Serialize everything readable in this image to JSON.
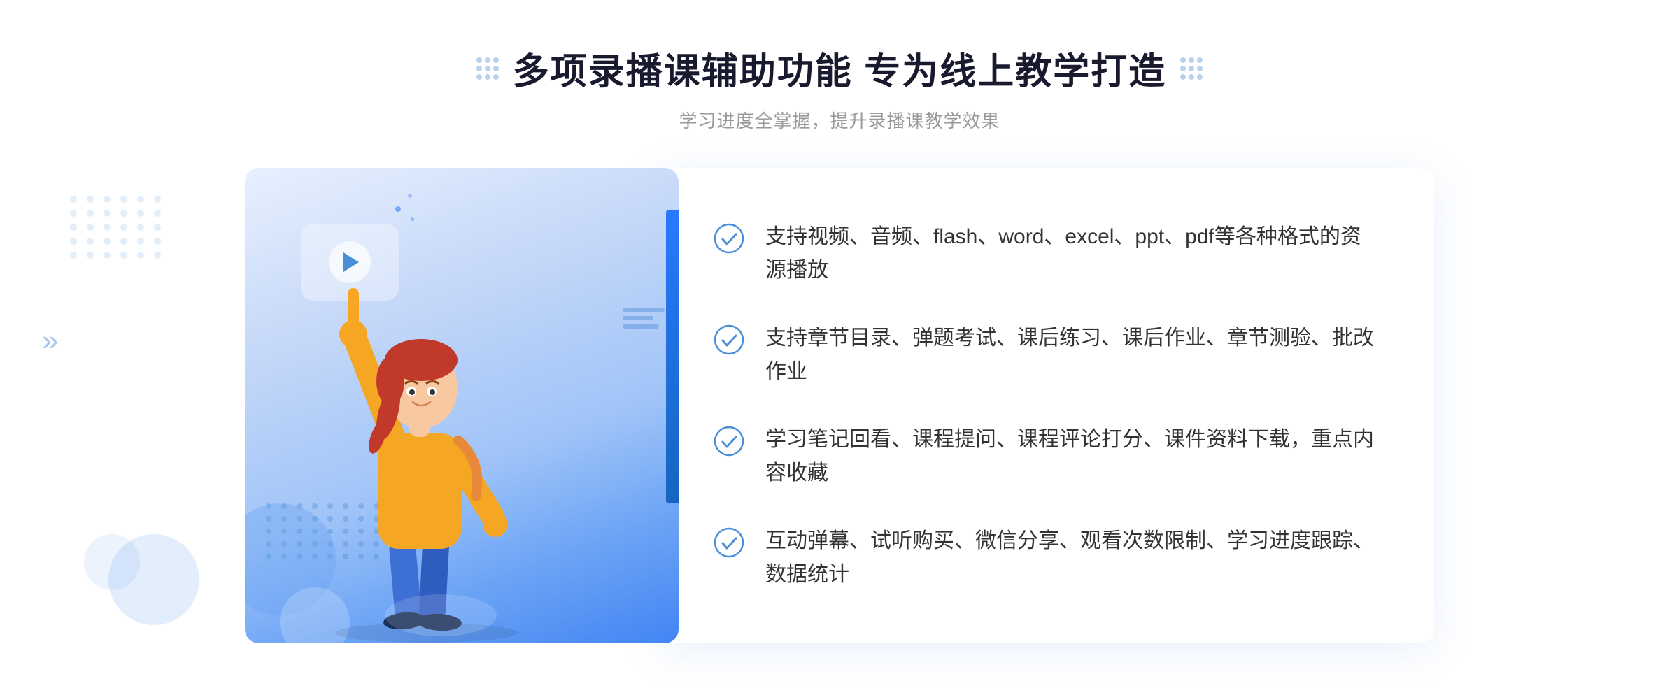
{
  "header": {
    "title": "多项录播课辅助功能 专为线上教学打造",
    "subtitle": "学习进度全掌握，提升录播课教学效果"
  },
  "features": [
    {
      "id": "feature-1",
      "text": "支持视频、音频、flash、word、excel、ppt、pdf等各种格式的资源播放"
    },
    {
      "id": "feature-2",
      "text": "支持章节目录、弹题考试、课后练习、课后作业、章节测验、批改作业"
    },
    {
      "id": "feature-3",
      "text": "学习笔记回看、课程提问、课程评论打分、课件资料下载，重点内容收藏"
    },
    {
      "id": "feature-4",
      "text": "互动弹幕、试听购买、微信分享、观看次数限制、学习进度跟踪、数据统计"
    }
  ],
  "colors": {
    "primary": "#4285f4",
    "check": "#4a90d9",
    "title": "#1a1a2e",
    "subtitle": "#999999",
    "text": "#333333"
  }
}
